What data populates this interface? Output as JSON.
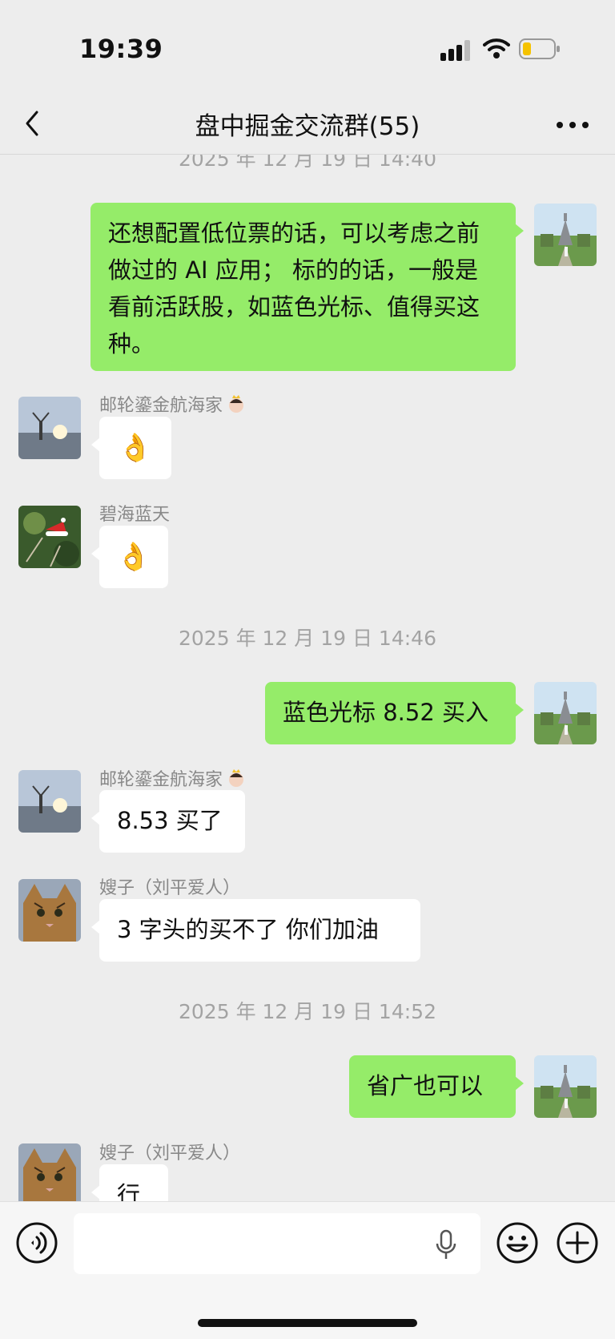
{
  "status_bar": {
    "time": "19:39",
    "signal_icon": "cellular-signal-icon",
    "wifi_icon": "wifi-icon",
    "battery_icon": "battery-low-icon",
    "battery_color": "#f5c200"
  },
  "nav": {
    "title": "盘中掘金交流群(55)",
    "back_icon": "chevron-left-icon",
    "more_icon": "ellipsis-icon"
  },
  "chat": {
    "times": [
      "2025 年 12 月 19 日 14:40",
      "2025 年 12 月 19 日 14:46",
      "2025 年 12 月 19 日 14:52"
    ],
    "messages": [
      {
        "direction": "out",
        "text": "还想配置低位票的话，可以考虑之前做过的 AI 应用； 标的的话，一般是看前活跃股，如蓝色光标、值得买这种。"
      },
      {
        "direction": "in",
        "sender": "邮轮鎏金航海家",
        "emoji": "👌"
      },
      {
        "direction": "in",
        "sender": "碧海蓝天",
        "emoji": "👌"
      },
      {
        "direction": "out",
        "text": "蓝色光标 8.52 买入"
      },
      {
        "direction": "in",
        "sender": "邮轮鎏金航海家",
        "text": "8.53 买了"
      },
      {
        "direction": "in",
        "sender": "嫂子（刘平爱人）",
        "text": "3 字头的买不了 你们加油"
      },
      {
        "direction": "out",
        "text": "省广也可以"
      },
      {
        "direction": "in",
        "sender": "嫂子（刘平爱人）",
        "text": "行"
      }
    ]
  },
  "input_bar": {
    "placeholder": "",
    "voice_icon": "voice-mode-icon",
    "mic_icon": "microphone-icon",
    "emoji_icon": "smiley-icon",
    "plus_icon": "plus-circle-icon"
  },
  "colors": {
    "outgoing_bubble": "#95ec69",
    "incoming_bubble": "#ffffff",
    "background": "#ededed",
    "timestamp": "#a3a3a3"
  }
}
